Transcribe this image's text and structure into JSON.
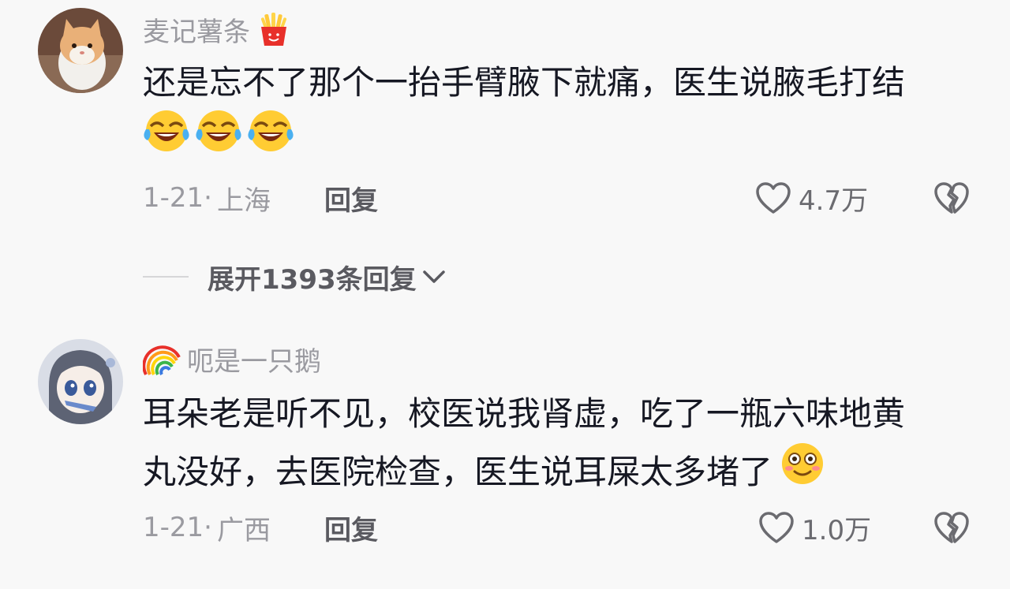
{
  "comments": [
    {
      "username": "麦记薯条",
      "username_badge": "fries-icon",
      "text_line1": "还是忘不了那个一抬手臂腋下就痛，医生说腋毛打结",
      "text_emojis": [
        "laugh-cry-icon",
        "laugh-cry-icon",
        "laugh-cry-icon"
      ],
      "date": "1-21·",
      "location": "上海",
      "reply_label": "回复",
      "likes": "4.7万"
    },
    {
      "username": "呃是一只鹅",
      "username_badge": "rainbow-icon",
      "text_line1": "耳朵老是听不见，校医说我肾虚，吃了一瓶六味地黄",
      "text_line2": "丸没好，去医院检查，医生说耳屎太多堵了",
      "text_emojis": [
        "flushed-smile-icon"
      ],
      "date": "1-21·",
      "location": "广西",
      "reply_label": "回复",
      "likes": "1.0万"
    }
  ],
  "expand": {
    "label": "展开1393条回复"
  },
  "colors": {
    "background": "#f8f8f8",
    "text": "#161823",
    "secondary": "#9a9aa0",
    "emoji_yellow": "#ffcc33"
  }
}
